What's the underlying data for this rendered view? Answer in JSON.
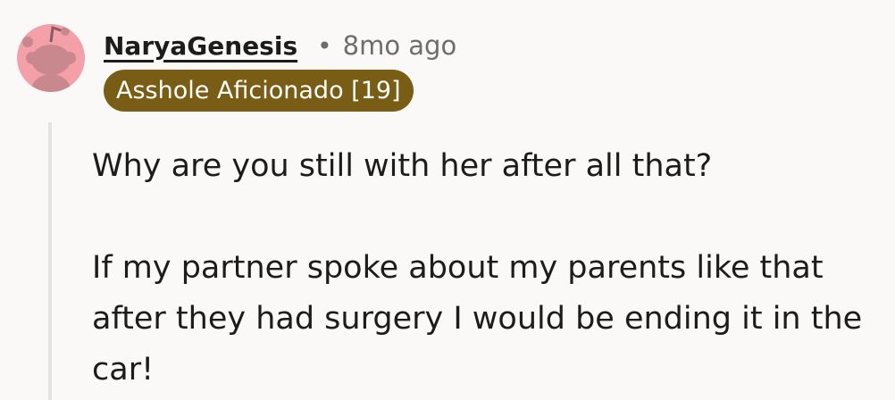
{
  "comment": {
    "author": "NaryaGenesis",
    "separator": "•",
    "timestamp": "8mo ago",
    "flair": "Asshole Aficionado [19]",
    "paragraphs": [
      "Why are you still with her after all that?",
      "If my partner spoke about my parents like that after they had surgery I would be ending it in the car!"
    ]
  },
  "colors": {
    "background": "#faf9f8",
    "text": "#1c1c1c",
    "muted": "#6f6c6a",
    "flair_bg": "#7a5d14",
    "avatar_pink": "#f3a0a8",
    "thread_line": "#e7e3e0"
  },
  "icons": {
    "avatar": "snoo-avatar-icon"
  }
}
